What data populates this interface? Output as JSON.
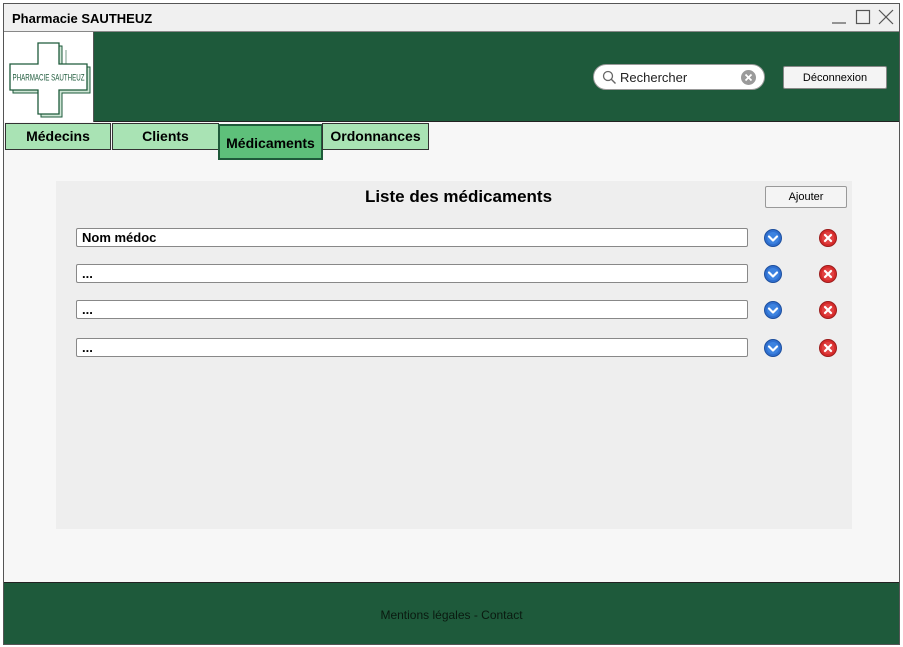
{
  "window": {
    "title": "Pharmacie SAUTHEUZ",
    "controls": [
      "minimize-icon",
      "maximize-icon",
      "close-icon"
    ]
  },
  "header": {
    "logo_text": "PHARMACIE SAUTHEUZ",
    "logo_icon": "pharmacy-cross-logo",
    "search": {
      "placeholder": "Rechercher",
      "value": ""
    },
    "logout_label": "Déconnexion"
  },
  "tabs": [
    {
      "label": "Médecins",
      "active": false
    },
    {
      "label": "Clients",
      "active": false
    },
    {
      "label": "Médicaments",
      "active": true
    },
    {
      "label": "Ordonnances",
      "active": false
    }
  ],
  "panel": {
    "title": "Liste des médicaments",
    "add_label": "Ajouter",
    "rows": [
      {
        "value": "Nom médoc"
      },
      {
        "value": "..."
      },
      {
        "value": "..."
      },
      {
        "value": "..."
      }
    ],
    "row_actions": [
      "chevron-down-circle-icon",
      "delete-circle-icon"
    ]
  },
  "footer": {
    "links": "Mentions légales - Contact"
  },
  "colors": {
    "header_bg": "#1e5a3b",
    "tab_bg": "#a9e3b4",
    "tab_active_bg": "#5ec07a",
    "panel_bg": "#eeeeee",
    "expand_icon": "#2f6fcf",
    "delete_icon": "#d62b2b"
  }
}
